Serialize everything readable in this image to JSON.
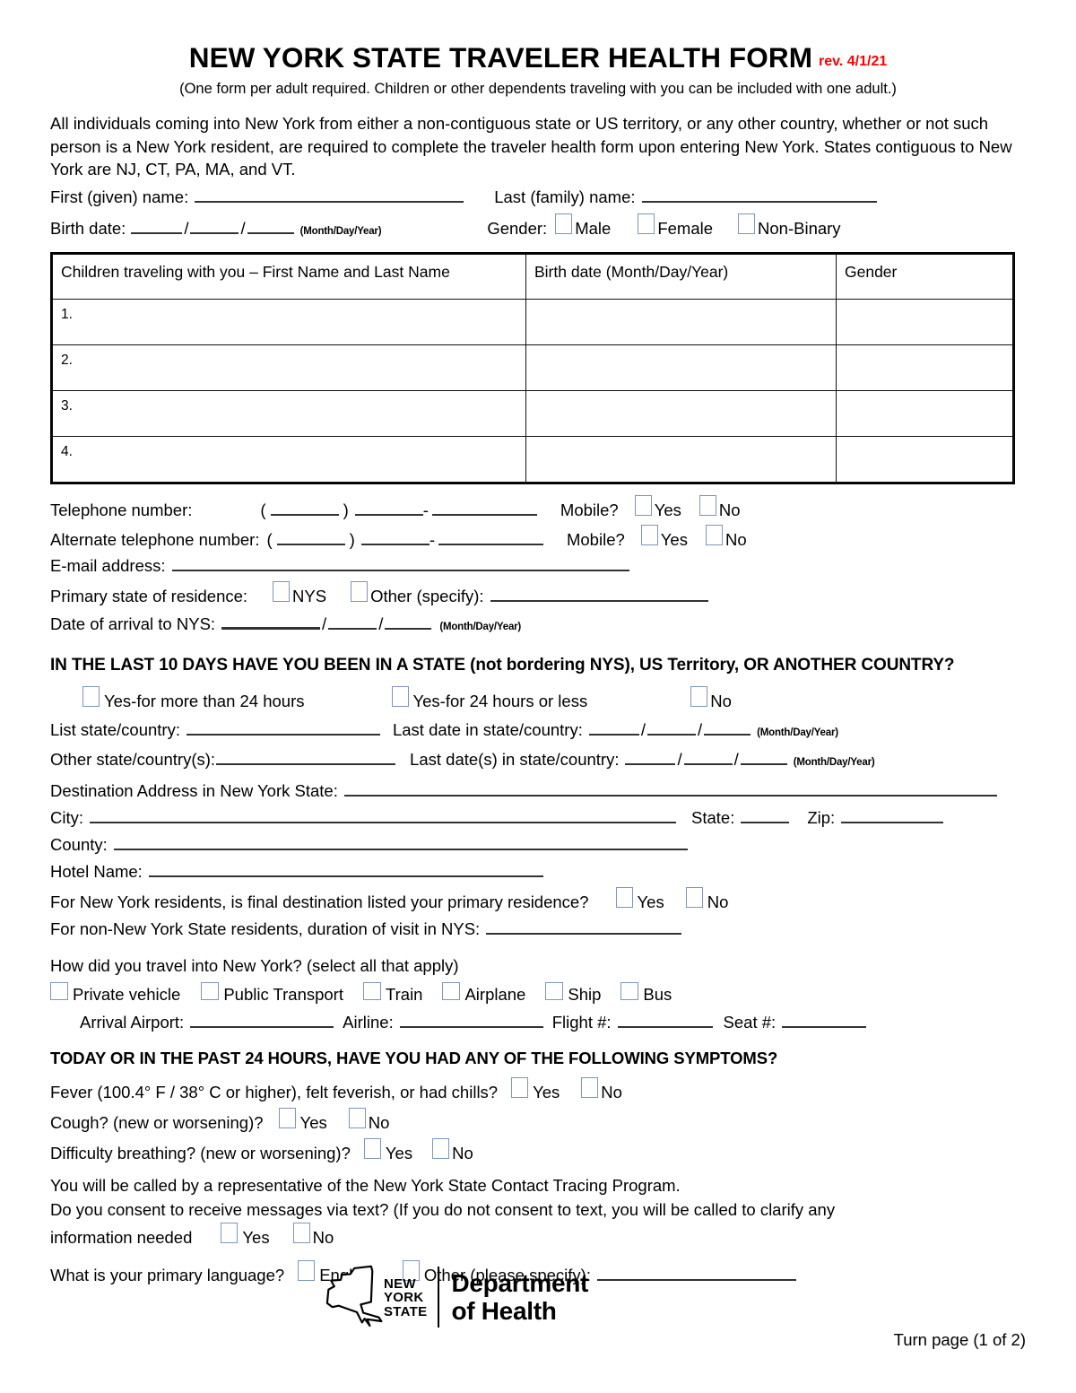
{
  "header": {
    "title": "NEW YORK STATE TRAVELER HEALTH FORM",
    "revision": "rev. 4/1/21",
    "subtitle": "(One form per adult required. Children or other dependents traveling with you can be included with one adult.)",
    "revision_color": "#ff0000"
  },
  "intro": {
    "paragraph": "All individuals coming into New York from either a non-contiguous state or US territory, or any other country, whether or not such person is a New York resident, are required to complete the traveler health form upon entering New York. States contiguous to New York are NJ, CT, PA, MA, and VT."
  },
  "identity": {
    "first_name_label": "First (given) name:",
    "last_name_label": "Last (family) name:",
    "birth_date_label": "Birth date:",
    "date_hint": "(Month/Day/Year)",
    "gender_label": "Gender:",
    "gender_options": [
      "Male",
      "Female",
      "Non-Binary"
    ]
  },
  "children_table": {
    "columns": [
      "Children traveling with you – First Name and Last Name",
      "Birth date (Month/Day/Year)",
      "Gender"
    ],
    "rows": [
      {
        "num": "1.",
        "name": "",
        "birth_date": "",
        "gender": ""
      },
      {
        "num": "2.",
        "name": "",
        "birth_date": "",
        "gender": ""
      },
      {
        "num": "3.",
        "name": "",
        "birth_date": "",
        "gender": ""
      },
      {
        "num": "4.",
        "name": "",
        "birth_date": "",
        "gender": ""
      }
    ]
  },
  "contact": {
    "telephone_label": "Telephone number:",
    "alt_telephone_label": "Alternate telephone number:",
    "mobile_label": "Mobile?",
    "yes": "Yes",
    "no": "No",
    "email_label": "E-mail address:",
    "primary_state_label": "Primary state of residence:",
    "nys_option": "NYS",
    "other_option": "Other (specify):",
    "arrival_label": "Date of arrival to NYS:",
    "arrival_hint": "(Month/Day/Year)"
  },
  "last10": {
    "heading": "IN THE LAST 10 DAYS HAVE YOU BEEN IN A STATE (not bordering NYS), US Territory, OR ANOTHER COUNTRY?",
    "options": [
      "Yes-for more than 24 hours",
      "Yes-for 24 hours or less",
      "No"
    ],
    "list_state_label": "List state/country:",
    "last_date_label": "Last date in state/country:",
    "last_date_hint": "(Month/Day/Year)",
    "other_state_label": "Other state/country(s):",
    "last_dates_label": "Last date(s) in state/country:",
    "last_dates_hint": "(Month/Day/Year)"
  },
  "destination": {
    "address_label": "Destination Address in New York State:",
    "city_label": "City:",
    "state_label": "State:",
    "zip_label": "Zip:",
    "county_label": "County:",
    "hotel_label": "Hotel Name:",
    "primary_residence_question": "For New York residents, is final destination listed your primary residence?",
    "yes": "Yes",
    "no": "No",
    "duration_label": "For non-New York State residents, duration of visit in NYS:"
  },
  "travel": {
    "question": "How did you travel into New York? (select all that apply)",
    "modes": [
      "Private vehicle",
      "Public Transport",
      "Train",
      "Airplane",
      "Ship",
      "Bus"
    ],
    "arrival_airport_label": "Arrival Airport:",
    "airline_label": "Airline:",
    "flight_label": "Flight #:",
    "seat_label": "Seat #:"
  },
  "symptoms": {
    "heading": "TODAY OR IN THE PAST 24 HOURS, HAVE YOU HAD ANY OF THE FOLLOWING SYMPTOMS?",
    "items": [
      {
        "label": "Fever (100.4° F / 38° C or higher), felt feverish, or had chills?",
        "yes": "Yes",
        "no": "No"
      },
      {
        "label": "Cough? (new or worsening)?",
        "yes": "Yes",
        "no": "No"
      },
      {
        "label": "Difficulty breathing? (new or worsening)?",
        "yes": "Yes",
        "no": "No"
      }
    ]
  },
  "consent": {
    "line1": "You will be called by a representative of the New York State Contact Tracing Program.",
    "line2": "Do you consent to receive messages via text? (If you do not consent to text, you will be called to clarify any",
    "line3": "information needed",
    "yes": "Yes",
    "no": "No",
    "language_question": "What is your primary language?",
    "english": "English",
    "other": "Other (please specify):"
  },
  "footer": {
    "logo_line1": "NEW",
    "logo_line2": "YORK",
    "logo_line3": "STATE",
    "dept_line1": "Department",
    "dept_line2": "of Health",
    "page_note": "Turn page (1 of 2)"
  }
}
